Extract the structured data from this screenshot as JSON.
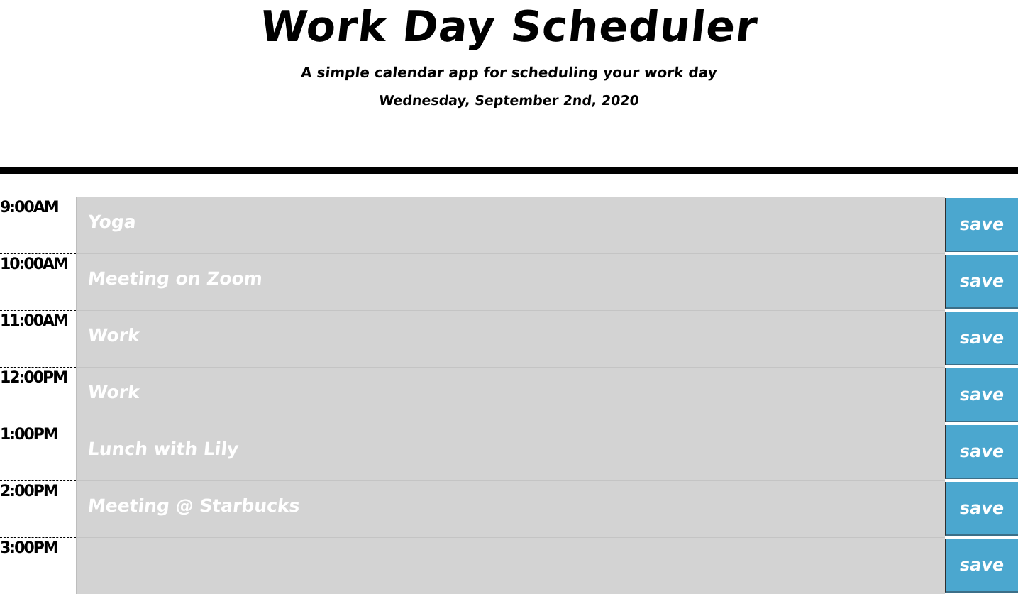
{
  "header": {
    "title": "Work Day Scheduler",
    "lead": "A simple calendar app for scheduling your work day",
    "current_day": "Wednesday, September 2nd, 2020"
  },
  "colors": {
    "past_row": "#d3d3d3",
    "save_button": "#4ba7cf",
    "text_light": "#ffffff"
  },
  "timeblocks": [
    {
      "hour": "9:00AM",
      "description": "Yoga",
      "save_label": "save"
    },
    {
      "hour": "10:00AM",
      "description": "Meeting on Zoom",
      "save_label": "save"
    },
    {
      "hour": "11:00AM",
      "description": "Work",
      "save_label": "save"
    },
    {
      "hour": "12:00PM",
      "description": "Work",
      "save_label": "save"
    },
    {
      "hour": "1:00PM",
      "description": "Lunch with Lily",
      "save_label": "save"
    },
    {
      "hour": "2:00PM",
      "description": "Meeting @ Starbucks",
      "save_label": "save"
    },
    {
      "hour": "3:00PM",
      "description": "",
      "save_label": "save"
    }
  ]
}
